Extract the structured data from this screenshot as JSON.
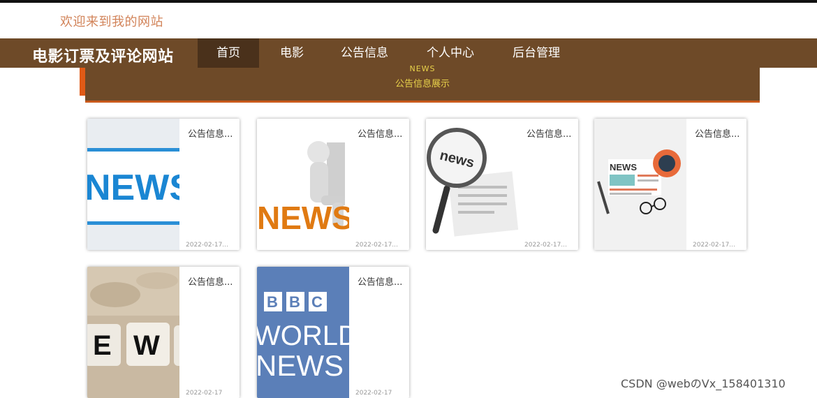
{
  "header": {
    "welcome": "欢迎来到我的网站"
  },
  "nav": {
    "site_title": "电影订票及评论网站",
    "items": [
      {
        "label": "首页",
        "active": true
      },
      {
        "label": "电影",
        "active": false
      },
      {
        "label": "公告信息",
        "active": false
      },
      {
        "label": "个人中心",
        "active": false
      },
      {
        "label": "后台管理",
        "active": false
      }
    ]
  },
  "section": {
    "title_en": "NEWS",
    "title_cn": "公告信息展示"
  },
  "cards": [
    {
      "title": "公告信息...",
      "date": "2022-02-17...",
      "image": "news-blue-banner"
    },
    {
      "title": "公告信息...",
      "date": "2022-02-17...",
      "image": "news-3d-figure"
    },
    {
      "title": "公告信息...",
      "date": "2022-02-17...",
      "image": "news-magnifier"
    },
    {
      "title": "公告信息...",
      "date": "2022-02-17...",
      "image": "news-flat-illustration"
    },
    {
      "title": "公告信息...",
      "date": "2022-02-17",
      "image": "news-letter-blocks"
    },
    {
      "title": "公告信息...",
      "date": "2022-02-17",
      "image": "bbc-world-news"
    }
  ],
  "watermark": "CSDN @webのVx_158401310",
  "colors": {
    "nav_bg": "#6e4a28",
    "nav_active": "#4a311b",
    "accent": "#e05a16",
    "banner_text": "#e8d24a"
  }
}
